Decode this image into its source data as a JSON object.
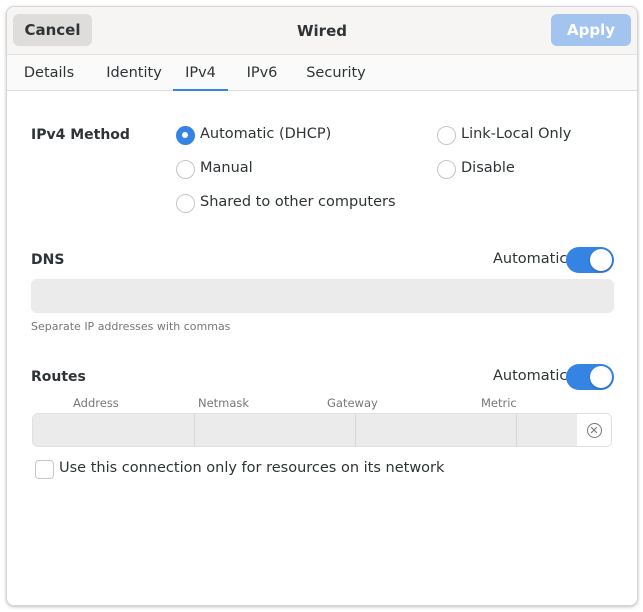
{
  "header": {
    "title": "Wired",
    "cancel_label": "Cancel",
    "apply_label": "Apply"
  },
  "tabs": [
    {
      "label": "Details"
    },
    {
      "label": "Identity"
    },
    {
      "label": "IPv4"
    },
    {
      "label": "IPv6"
    },
    {
      "label": "Security"
    }
  ],
  "active_tab": "IPv4",
  "method": {
    "label": "IPv4 Method",
    "selected": "Automatic (DHCP)",
    "options": [
      {
        "label": "Automatic (DHCP)"
      },
      {
        "label": "Link-Local Only"
      },
      {
        "label": "Manual"
      },
      {
        "label": "Disable"
      },
      {
        "label": "Shared to other computers"
      }
    ]
  },
  "dns": {
    "label": "DNS",
    "automatic_label": "Automatic",
    "automatic_on": true,
    "value": "",
    "hint": "Separate IP addresses with commas"
  },
  "routes": {
    "label": "Routes",
    "automatic_label": "Automatic",
    "automatic_on": true,
    "columns": [
      "Address",
      "Netmask",
      "Gateway",
      "Metric"
    ],
    "row": {
      "address": "",
      "netmask": "",
      "gateway": "",
      "metric": ""
    }
  },
  "only_resources": {
    "label": "Use this connection only for resources on its network",
    "checked": false
  },
  "colors": {
    "accent": "#3584e4",
    "apply_disabled": "#a2c4ee"
  }
}
